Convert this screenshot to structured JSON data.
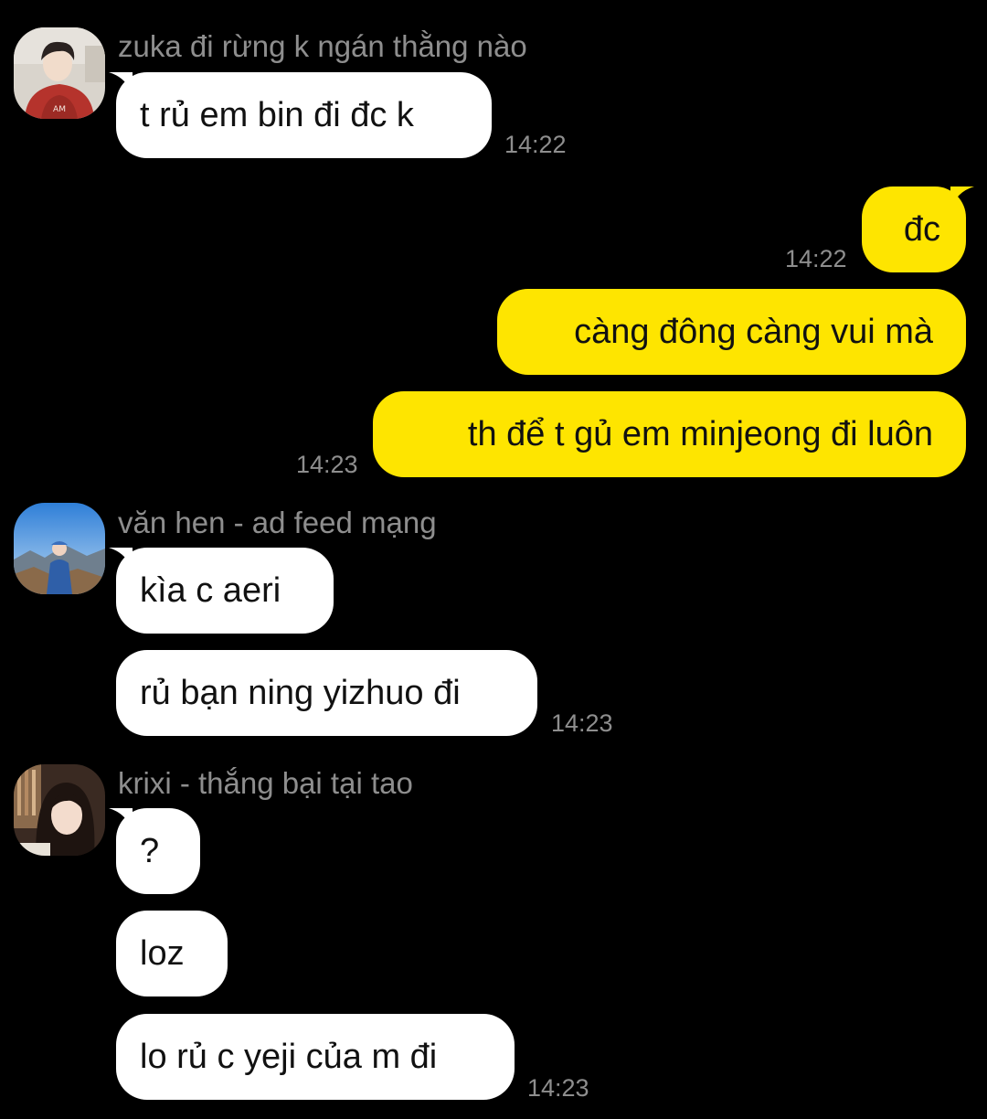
{
  "colors": {
    "background": "#000000",
    "incoming_bubble": "#ffffff",
    "outgoing_bubble": "#fee500",
    "meta_text": "#8e8e8e"
  },
  "groups": [
    {
      "sender": "zuka đi rừng k ngán thằng nào",
      "avatar": "avatar-zuka",
      "messages": [
        "t rủ em bin đi đc k"
      ],
      "time": "14:22"
    },
    {
      "sender": "văn hen - ad feed mạng",
      "avatar": "avatar-van-hen",
      "messages": [
        "kìa c aeri",
        "rủ bạn ning yizhuo đi"
      ],
      "time": "14:23"
    },
    {
      "sender": "krixi - thắng bại tại tao",
      "avatar": "avatar-krixi",
      "messages": [
        "?",
        "loz",
        "lo rủ c yeji của m đi"
      ],
      "time": "14:23"
    }
  ],
  "outgoing": [
    {
      "text": "đc",
      "time": "14:22"
    },
    {
      "text": "càng đông càng vui mà",
      "time": ""
    },
    {
      "text": "th để t gủ em minjeong đi luôn",
      "time": "14:23"
    }
  ]
}
